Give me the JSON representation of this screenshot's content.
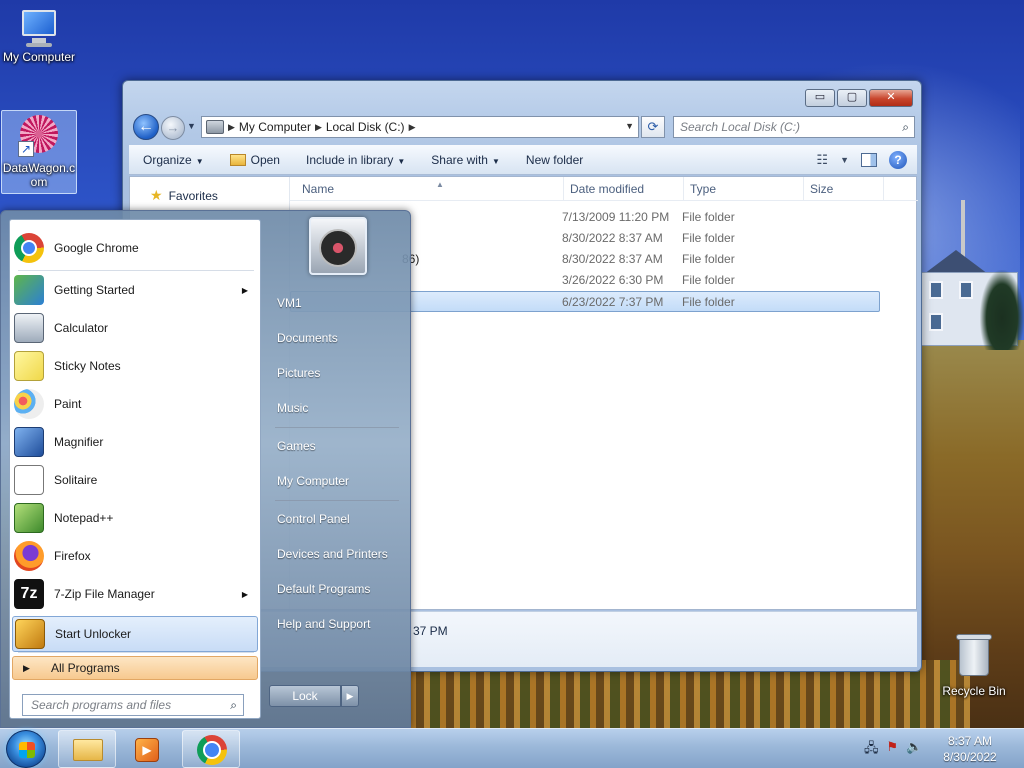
{
  "desktop": {
    "icons": [
      {
        "label": "My Computer"
      },
      {
        "label": "DataWagon.com"
      },
      {
        "label": "Recycle Bin"
      }
    ]
  },
  "explorer": {
    "title_buttons": {
      "minimize": "▭",
      "maximize": "▢",
      "close": "✕"
    },
    "address": {
      "segments": [
        "My Computer",
        "Local Disk (C:)"
      ]
    },
    "search_placeholder": "Search Local Disk (C:)",
    "toolbar": {
      "organize": "Organize",
      "open": "Open",
      "include_in_library": "Include in library",
      "share_with": "Share with",
      "new_folder": "New folder"
    },
    "nav": {
      "favorites": "Favorites"
    },
    "columns": {
      "name": "Name",
      "date_modified": "Date modified",
      "type": "Type",
      "size": "Size"
    },
    "rows": [
      {
        "name": "",
        "date": "7/13/2009 11:20 PM",
        "type": "File folder"
      },
      {
        "name": "",
        "date": "8/30/2022 8:37 AM",
        "type": "File folder"
      },
      {
        "name": "86)",
        "date": "8/30/2022 8:37 AM",
        "type": "File folder"
      },
      {
        "name": "",
        "date": "3/26/2022 6:30 PM",
        "type": "File folder"
      },
      {
        "name": "",
        "date": "6/23/2022 7:37 PM",
        "type": "File folder"
      }
    ],
    "details_text": "37 PM"
  },
  "start_menu": {
    "programs": [
      {
        "label": "Google Chrome",
        "icon": "chrome-icon"
      },
      {
        "label": "Getting Started",
        "icon": "getting-started-icon"
      },
      {
        "label": "Calculator",
        "icon": "calculator-icon"
      },
      {
        "label": "Sticky Notes",
        "icon": "sticky-notes-icon"
      },
      {
        "label": "Paint",
        "icon": "paint-icon"
      },
      {
        "label": "Magnifier",
        "icon": "magnifier-icon"
      },
      {
        "label": "Solitaire",
        "icon": "solitaire-icon"
      },
      {
        "label": "Notepad++",
        "icon": "notepad-plus-plus-icon"
      },
      {
        "label": "Firefox",
        "icon": "firefox-icon"
      },
      {
        "label": "7-Zip File Manager",
        "icon": "seven-zip-icon"
      },
      {
        "label": "Start Unlocker",
        "icon": "unlocker-icon"
      }
    ],
    "all_programs": "All Programs",
    "search_placeholder": "Search programs and files",
    "right_items": [
      "VM1",
      "Documents",
      "Pictures",
      "Music",
      "Games",
      "My Computer",
      "Control Panel",
      "Devices and Printers",
      "Default Programs",
      "Help and Support"
    ],
    "lock": "Lock"
  },
  "taskbar": {
    "clock_time": "8:37 AM",
    "clock_date": "8/30/2022"
  }
}
